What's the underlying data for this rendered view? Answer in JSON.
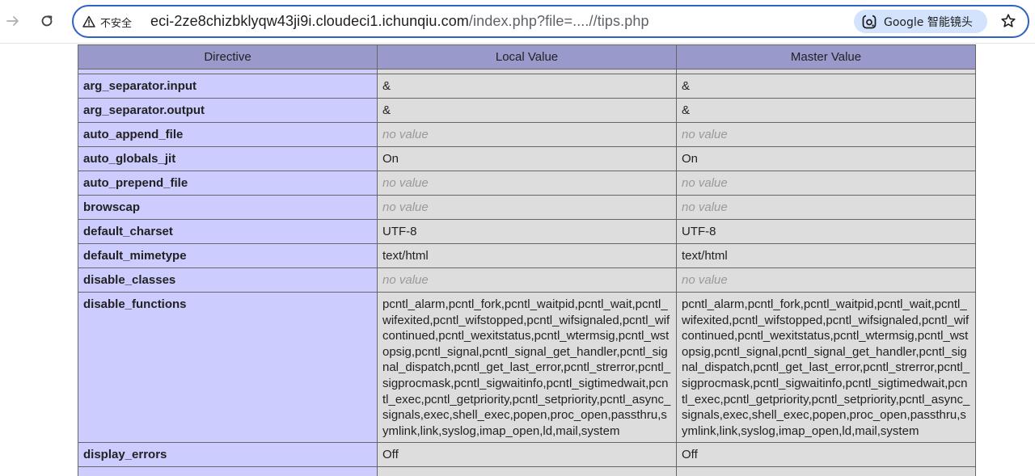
{
  "browser": {
    "security_label": "不安全",
    "url_host": "eci-2ze8chizbklyqw43ji9i.cloudeci1.ichunqiu.com",
    "url_path": "/index.php?file=....//tips.php",
    "lens_label": "Google 智能镜头",
    "icons": {
      "back": "arrow-right-icon",
      "reload": "reload-icon",
      "warning": "warning-triangle-icon",
      "lens": "google-lens-icon",
      "star": "star-outline-icon"
    }
  },
  "table": {
    "headers": [
      "Directive",
      "Local Value",
      "Master Value"
    ],
    "rows": [
      {
        "directive": "arg_separator.input",
        "local": "&",
        "master": "&",
        "novalue": false
      },
      {
        "directive": "arg_separator.output",
        "local": "&",
        "master": "&",
        "novalue": false
      },
      {
        "directive": "auto_append_file",
        "local": "no value",
        "master": "no value",
        "novalue": true
      },
      {
        "directive": "auto_globals_jit",
        "local": "On",
        "master": "On",
        "novalue": false
      },
      {
        "directive": "auto_prepend_file",
        "local": "no value",
        "master": "no value",
        "novalue": true
      },
      {
        "directive": "browscap",
        "local": "no value",
        "master": "no value",
        "novalue": true
      },
      {
        "directive": "default_charset",
        "local": "UTF-8",
        "master": "UTF-8",
        "novalue": false
      },
      {
        "directive": "default_mimetype",
        "local": "text/html",
        "master": "text/html",
        "novalue": false
      },
      {
        "directive": "disable_classes",
        "local": "no value",
        "master": "no value",
        "novalue": true
      },
      {
        "directive": "disable_functions",
        "local": "pcntl_alarm,pcntl_fork,pcntl_waitpid,pcntl_wait,pcntl_wifexited,pcntl_wifstopped,pcntl_wifsignaled,pcntl_wifcontinued,pcntl_wexitstatus,pcntl_wtermsig,pcntl_wstopsig,pcntl_signal,pcntl_signal_get_handler,pcntl_signal_dispatch,pcntl_get_last_error,pcntl_strerror,pcntl_sigprocmask,pcntl_sigwaitinfo,pcntl_sigtimedwait,pcntl_exec,pcntl_getpriority,pcntl_setpriority,pcntl_async_signals,exec,shell_exec,popen,proc_open,passthru,symlink,link,syslog,imap_open,ld,mail,system",
        "master": "pcntl_alarm,pcntl_fork,pcntl_waitpid,pcntl_wait,pcntl_wifexited,pcntl_wifstopped,pcntl_wifsignaled,pcntl_wifcontinued,pcntl_wexitstatus,pcntl_wtermsig,pcntl_wstopsig,pcntl_signal,pcntl_signal_get_handler,pcntl_signal_dispatch,pcntl_get_last_error,pcntl_strerror,pcntl_sigprocmask,pcntl_sigwaitinfo,pcntl_sigtimedwait,pcntl_exec,pcntl_getpriority,pcntl_setpriority,pcntl_async_signals,exec,shell_exec,popen,proc_open,passthru,symlink,link,syslog,imap_open,ld,mail,system",
        "novalue": false
      },
      {
        "directive": "display_errors",
        "local": "Off",
        "master": "Off",
        "novalue": false
      },
      {
        "directive": "",
        "local": "",
        "master": "",
        "novalue": false
      }
    ]
  },
  "colors": {
    "header_bg": "#9999cc",
    "directive_bg": "#ccccff",
    "value_bg": "#dddddd",
    "omnibox_border": "#2f61c6",
    "lens_bg": "#d3e3fd"
  }
}
